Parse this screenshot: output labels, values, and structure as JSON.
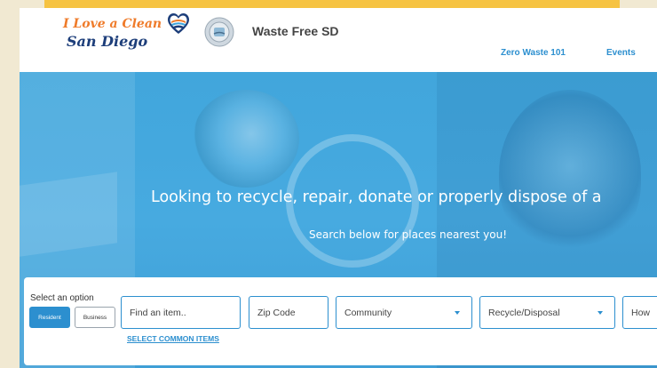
{
  "header": {
    "logo_line1": "I Love a Clean",
    "logo_line2": "San Diego",
    "site_title": "Waste Free SD",
    "nav": [
      {
        "label": "Zero Waste 101"
      },
      {
        "label": "Events"
      }
    ]
  },
  "hero": {
    "heading": "Looking to recycle, repair, donate or properly dispose of a",
    "subheading": "Search below for places nearest you!"
  },
  "search": {
    "option_label": "Select an option",
    "toggles": [
      {
        "label": "Resident",
        "active": true
      },
      {
        "label": "Business",
        "active": false
      }
    ],
    "item_placeholder": "Find an item..",
    "zip_placeholder": "Zip Code",
    "community_value": "Community",
    "recycle_value": "Recycle/Disposal",
    "how_value": "How",
    "common_items_link": "SELECT COMMON ITEMS"
  },
  "colors": {
    "accent": "#2c8fcf",
    "hero_overlay": "#44a8de",
    "top_strip": "#f6c342",
    "page_bg": "#f1e9d2"
  }
}
